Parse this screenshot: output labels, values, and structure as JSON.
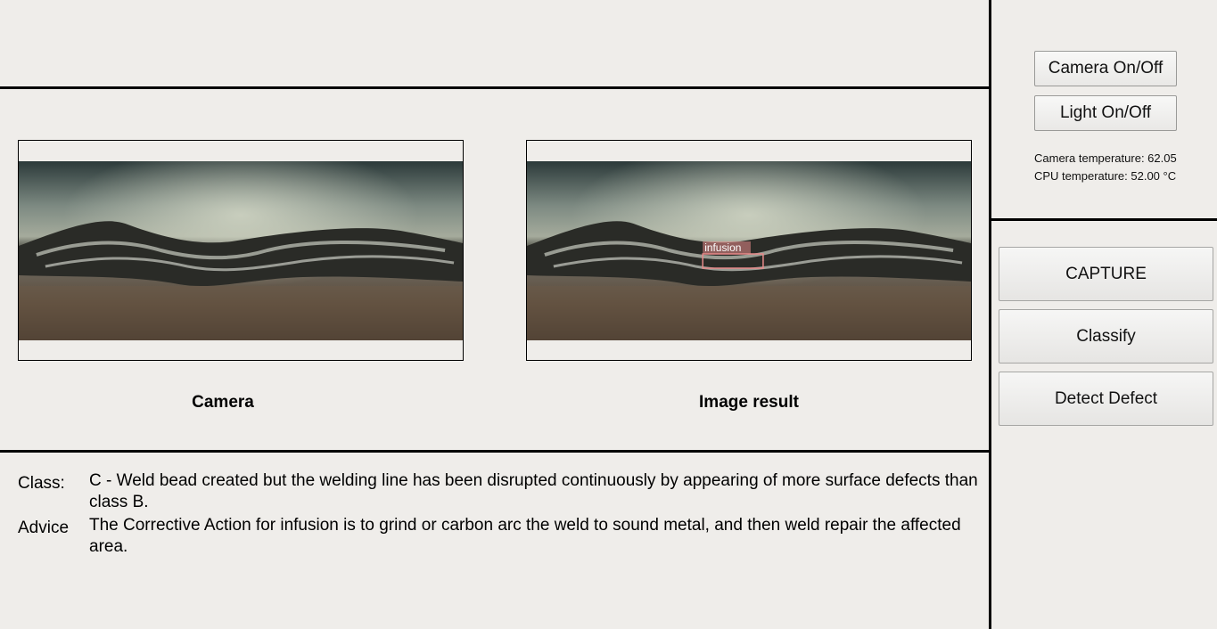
{
  "controls": {
    "camera_toggle": "Camera On/Off",
    "light_toggle": "Light On/Off",
    "camera_temperature": "Camera temperature: 62.05",
    "cpu_temperature": "CPU temperature: 52.00 °C",
    "capture": "CAPTURE",
    "classify": "Classify",
    "detect_defect": "Detect Defect"
  },
  "panels": {
    "camera_caption": "Camera",
    "result_caption": "Image result",
    "detection_label": "infusion",
    "detection_color": "#e88a8a"
  },
  "result": {
    "class_label": "Class:",
    "class_text": "C - Weld bead created but the welding line has been disrupted continuously by appearing of more surface defects than class B.",
    "advice_label": "Advice",
    "advice_text": "The Corrective Action for infusion is to grind or carbon arc the weld to sound metal, and then weld repair the affected area."
  }
}
